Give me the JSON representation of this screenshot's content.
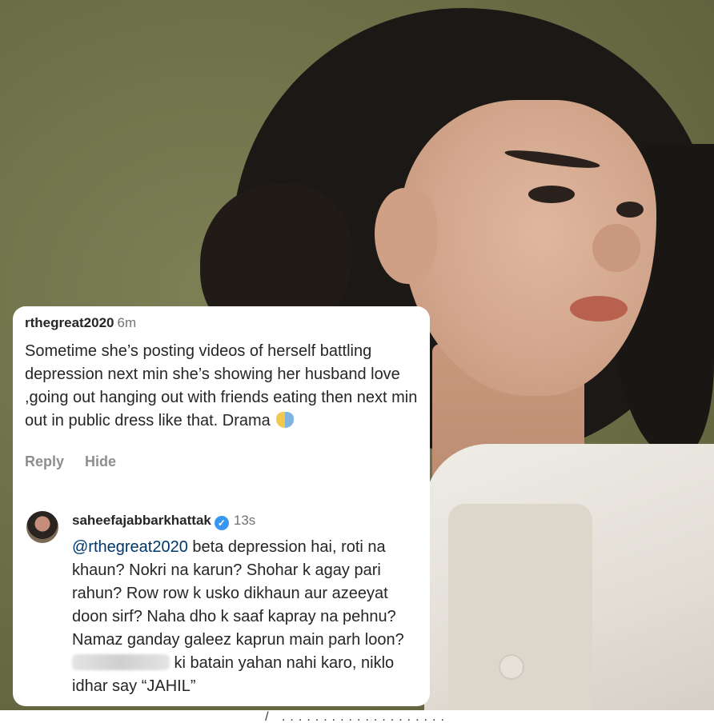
{
  "comment1": {
    "username": "rthegreat2020",
    "time": "6m",
    "text": "Sometime she’s posting videos of herself battling depression next min she’s showing her husband love ,going out hanging out with friends  eating  then next min out in public dress like that. Drama",
    "reply_label": "Reply",
    "hide_label": "Hide"
  },
  "comment2": {
    "username": "saheefajabbarkhattak",
    "time": "13s",
    "mention": "@rthegreat2020",
    "text_part1": " beta depression hai, roti na khaun? Nokri na karun? Shohar k agay pari rahun? Row row k usko dikhaun aur azeeyat doon sirf? Naha dho k saaf kapray na pehnu? Namaz ganday galeez kaprun main parh loon? ",
    "text_part2": " ki batain yahan nahi karo, niklo idhar say “JAHIL”"
  },
  "footer": {
    "text": "/ ...................."
  }
}
